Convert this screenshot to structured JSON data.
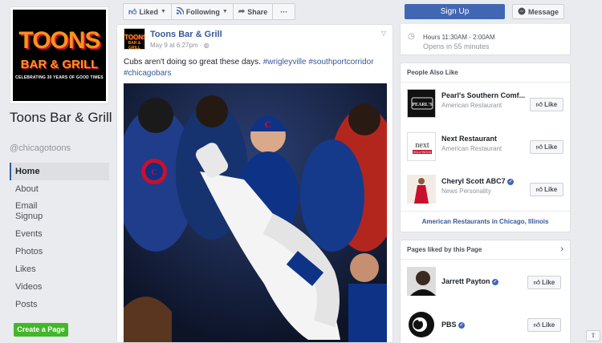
{
  "page": {
    "logo_title": "TOONS",
    "logo_sub": "BAR & GRILL",
    "logo_tag": "CELEBRATING 30 YEARS OF GOOD TIMES",
    "name": "Toons Bar & Grill",
    "handle": "@chicagotoons"
  },
  "nav": [
    {
      "label": "Home",
      "active": true
    },
    {
      "label": "About"
    },
    {
      "label": "Email Signup"
    },
    {
      "label": "Events"
    },
    {
      "label": "Photos"
    },
    {
      "label": "Likes"
    },
    {
      "label": "Videos"
    },
    {
      "label": "Posts"
    }
  ],
  "create_page": "Create a Page",
  "actions": {
    "liked": "Liked",
    "following": "Following",
    "share": "Share",
    "more": "···"
  },
  "post": {
    "author": "Toons Bar & Grill",
    "meta": "May 9 at 6:27pm · ",
    "text": "Cubs aren't doing so great these days.",
    "tags": [
      "#wrigleyville",
      "#southportcorridor",
      "#chicagobars"
    ]
  },
  "cta": {
    "signup": "Sign Up",
    "message": "Message"
  },
  "hours": {
    "text": "Hours 11:30AM - 2:00AM",
    "opens": "Opens in 55 minutes"
  },
  "people_also_like": {
    "title": "People Also Like",
    "items": [
      {
        "name": "Pearl's Southern Comf...",
        "sub": "American Restaurant",
        "like": "Like"
      },
      {
        "name": "Next Restaurant",
        "sub": "American Restaurant",
        "like": "Like"
      },
      {
        "name": "Cheryl Scott ABC7",
        "sub": "News Personality",
        "like": "Like",
        "verified": true
      }
    ],
    "link": "American Restaurants in Chicago, Illinois"
  },
  "pages_liked": {
    "title": "Pages liked by this Page",
    "items": [
      {
        "name": "Jarrett Payton",
        "like": "Like",
        "verified": true
      },
      {
        "name": "PBS",
        "like": "Like",
        "verified": true
      }
    ]
  },
  "colors": {
    "fb_blue": "#4267b2",
    "link": "#365899",
    "green": "#42b72a",
    "brand_orange": "#f7931e"
  }
}
